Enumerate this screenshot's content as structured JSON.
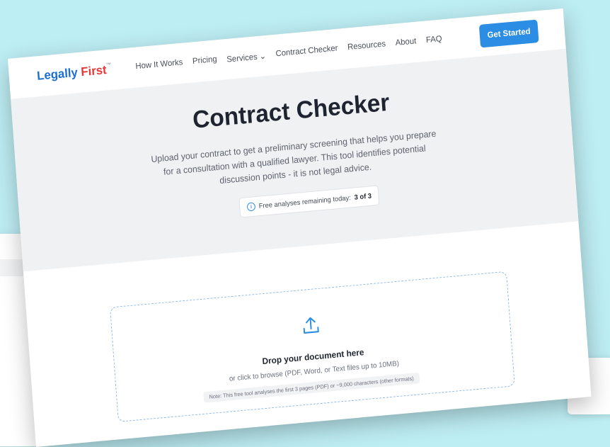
{
  "brand": {
    "name_main": "Legally",
    "name_accent": "First",
    "trademark": "™"
  },
  "nav": {
    "items": [
      {
        "label": "How It Works"
      },
      {
        "label": "Pricing"
      },
      {
        "label": "Services"
      },
      {
        "label": "Contract Checker"
      },
      {
        "label": "Resources"
      },
      {
        "label": "About"
      },
      {
        "label": "FAQ"
      }
    ],
    "cta_label": "Get Started"
  },
  "hero": {
    "title": "Contract Checker",
    "description": "Upload your contract to get a preliminary screening that helps you prepare for a consultation with a qualified lawyer. This tool identifies potential discussion points - it is not legal advice.",
    "quota_label": "Free analyses remaining today:",
    "quota_value": "3 of 3"
  },
  "upload": {
    "title": "Drop your document here",
    "subtitle": "or click to browse (PDF, Word, or Text files up to 10MB)",
    "note": "Note: This free tool analyses the first 3 pages (PDF) or ~9,000 characters (other formats)"
  },
  "colors": {
    "accent": "#2b8de3",
    "brand_blue": "#1b6fd1",
    "brand_red": "#e23a3a",
    "hero_bg": "#f0f1f3",
    "backdrop": "#bdeef4"
  },
  "icons": {
    "chevron": "chevron-down-icon",
    "info": "info-icon",
    "upload": "upload-icon"
  }
}
